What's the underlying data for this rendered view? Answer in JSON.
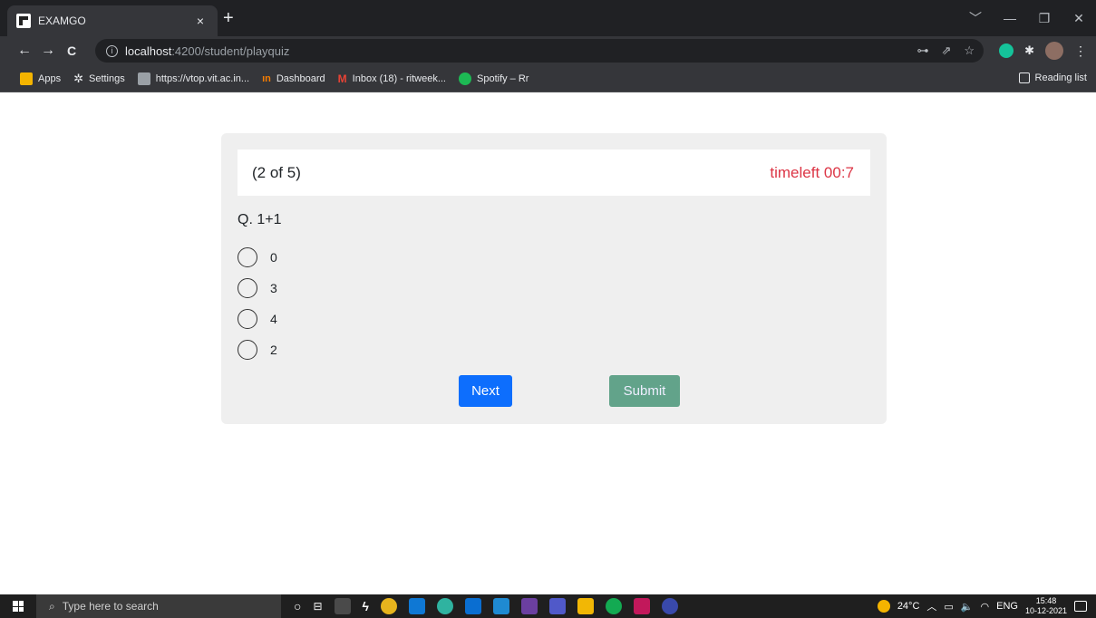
{
  "browser": {
    "tab_title": "EXAMGO",
    "tab_close": "×",
    "new_tab": "+",
    "window_controls": [
      "﹀",
      "—",
      "❐",
      "✕"
    ],
    "nav": {
      "back": "←",
      "forward": "→",
      "reload": "C"
    },
    "url_host": "localhost",
    "url_path": ":4200/student/playquiz",
    "bookmarks": [
      {
        "label": "Apps",
        "icon": "apps-grid-icon",
        "color": "#f4b400"
      },
      {
        "label": "Settings",
        "icon": "gear-icon",
        "color": "#e8eaed"
      },
      {
        "label": "https://vtop.vit.ac.in...",
        "icon": "vtop-icon",
        "color": "#9aa0a6"
      },
      {
        "label": "Dashboard",
        "icon": "dashboard-icon",
        "color": "#f57c00"
      },
      {
        "label": "Inbox (18) - ritweek...",
        "icon": "gmail-icon",
        "color": "#ea4335"
      },
      {
        "label": "Spotify – Rr",
        "icon": "spotify-icon",
        "color": "#1db954"
      }
    ],
    "reading_list": "Reading list"
  },
  "quiz": {
    "progress": "(2 of 5)",
    "timeleft": "timeleft 00:7",
    "question": "Q. 1+1",
    "options": [
      "0",
      "3",
      "4",
      "2"
    ],
    "next_label": "Next",
    "submit_label": "Submit",
    "colors": {
      "next": "#0d6efd",
      "submit": "#62a38a",
      "timer": "#dc3545"
    }
  },
  "taskbar": {
    "search_placeholder": "Type here to search",
    "weather": "24°C",
    "language": "ENG",
    "time": "15:48",
    "date": "10-12-2021"
  }
}
